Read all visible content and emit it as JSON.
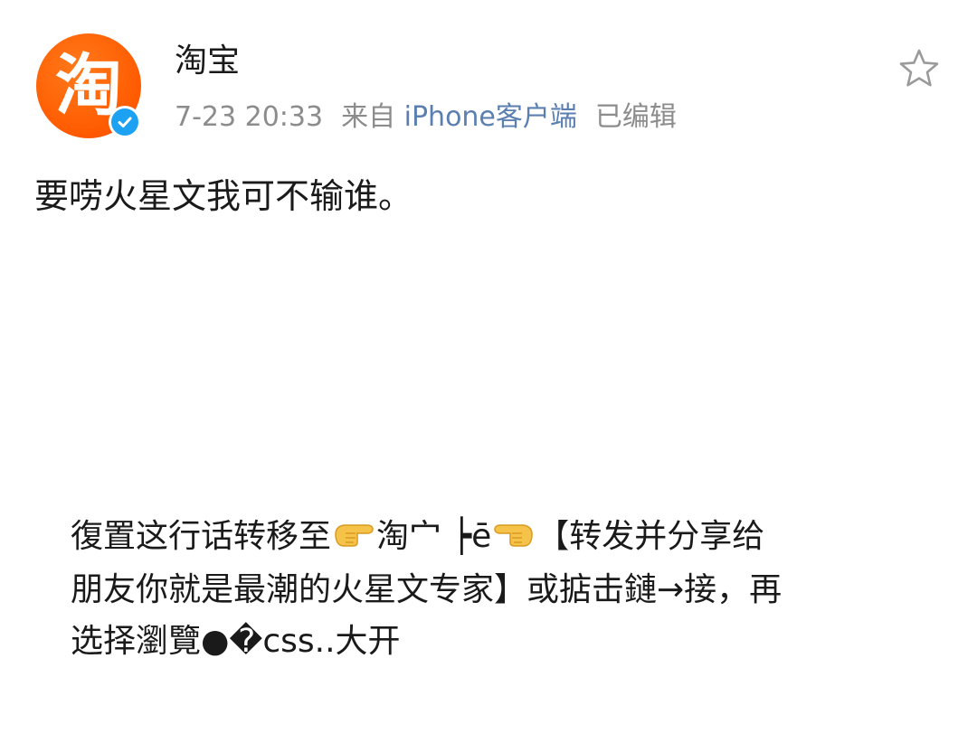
{
  "post": {
    "author": "淘宝",
    "avatar_glyph": "淘",
    "date": "7-23 20:33",
    "source_prefix": "来自",
    "source_client": "iPhone客户端",
    "edited": "已编辑",
    "text": "要唠火星文我可不输谁。"
  },
  "image_text": {
    "line1_a": "復置这行话转移至",
    "line1_b": "淘宀 ┝ē",
    "line1_c": "【转发并分享给",
    "line2": "朋友你就是最潮的火星文专家】或掂击鏈→接，再",
    "line3": "选择瀏覽●�css..大开"
  },
  "icons": {
    "star": "star-outline-icon",
    "verified": "verified-check-icon",
    "hand_right": "backhand-index-pointing-right-icon",
    "hand_left": "backhand-index-pointing-left-icon"
  },
  "colors": {
    "avatar_orange": "#ff5a00",
    "verified_blue": "#1da1f2",
    "client_link": "#5b7fb1",
    "meta_gray": "#8c8c8c",
    "emoji_yellow": "#f5c24a"
  }
}
